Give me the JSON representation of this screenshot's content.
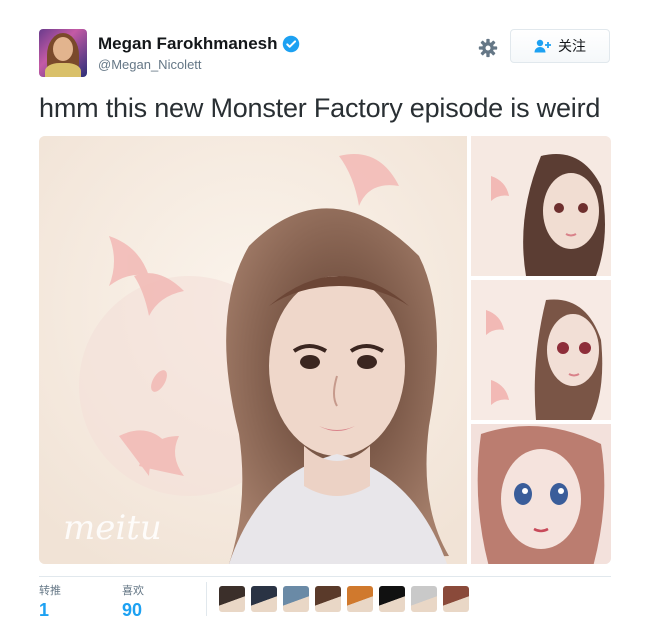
{
  "user": {
    "display_name": "Megan Farokhmanesh",
    "handle": "@Megan_Nicolett",
    "verified": true
  },
  "actions": {
    "follow_label": "关注",
    "settings_icon": "gear-icon",
    "follow_icon": "add-user-icon"
  },
  "tweet": {
    "text": "hmm this new Monster Factory episode is weird"
  },
  "media": {
    "watermark": "meitu",
    "image_count": 4
  },
  "stats": {
    "retweets_label": "转推",
    "retweets_count": "1",
    "likes_label": "喜欢",
    "likes_count": "90"
  },
  "likers": [
    {
      "color": "#3b2f2a"
    },
    {
      "color": "#2a3344"
    },
    {
      "color": "#6a8aa6"
    },
    {
      "color": "#5a3a2a"
    },
    {
      "color": "#d0792d"
    },
    {
      "color": "#111111"
    },
    {
      "color": "#c9c9c9"
    },
    {
      "color": "#8a4a3a"
    }
  ],
  "colors": {
    "link_blue": "#1da1f2",
    "text_primary": "#14171a",
    "text_secondary": "#657786"
  }
}
